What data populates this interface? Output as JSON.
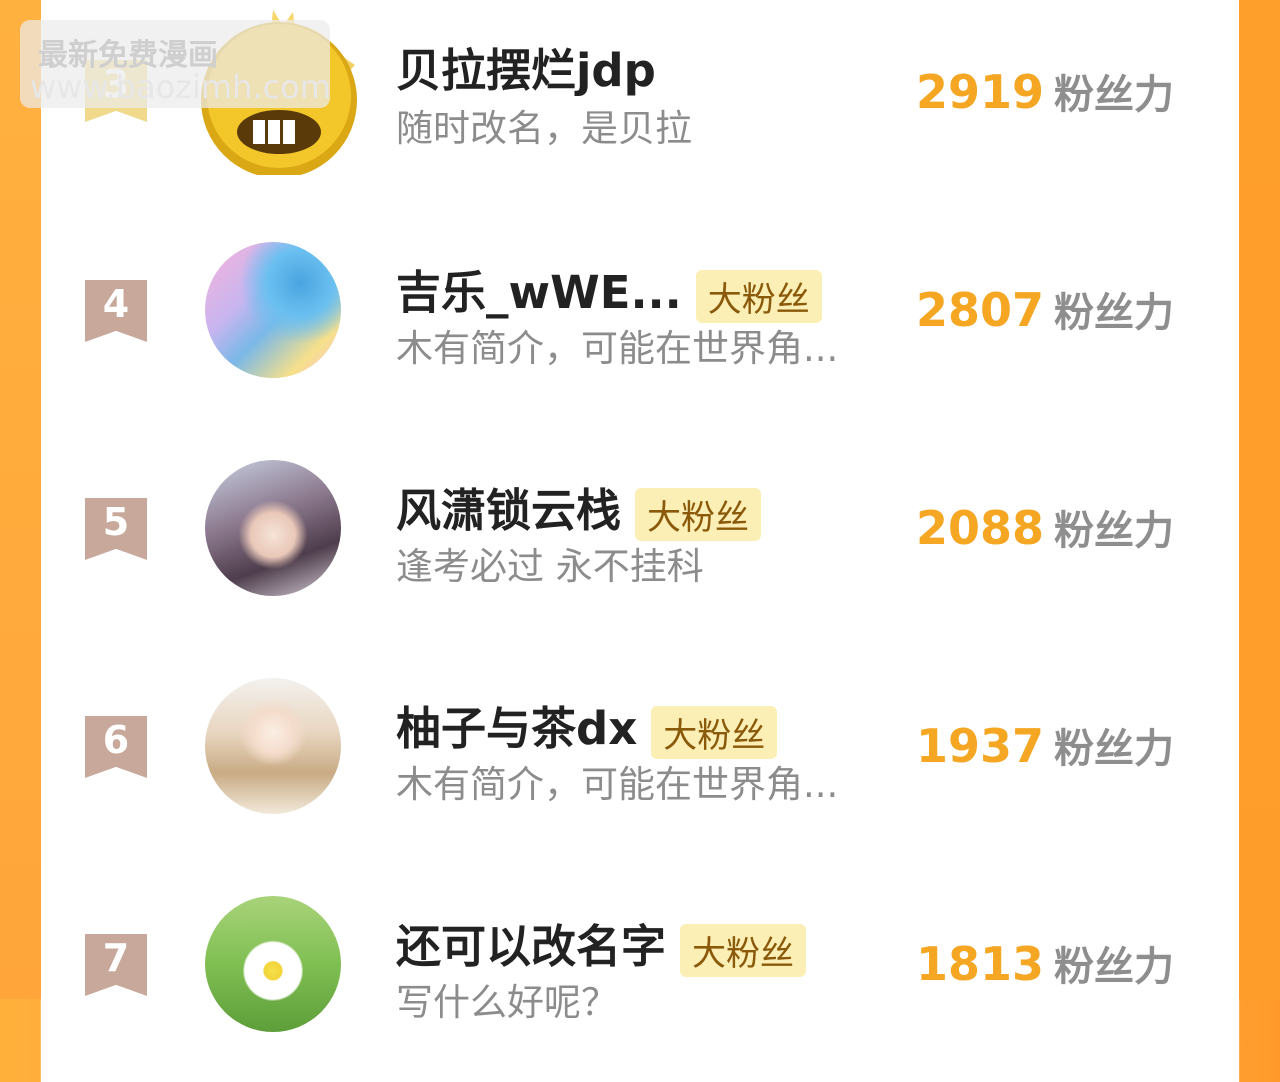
{
  "rows": [
    {
      "rank": "3",
      "name": "贝拉摆烂jdp",
      "badge": "",
      "bio": "随时改名，是贝拉",
      "score": "2919",
      "unit": "粉丝力"
    },
    {
      "rank": "4",
      "name": "吉乐_wWE...",
      "badge": "大粉丝",
      "bio": "木有简介，可能在世界角...",
      "score": "2807",
      "unit": "粉丝力"
    },
    {
      "rank": "5",
      "name": "风潇锁云栈",
      "badge": "大粉丝",
      "bio": "逢考必过 永不挂科",
      "score": "2088",
      "unit": "粉丝力"
    },
    {
      "rank": "6",
      "name": "柚子与茶dx",
      "badge": "大粉丝",
      "bio": "木有简介，可能在世界角...",
      "score": "1937",
      "unit": "粉丝力"
    },
    {
      "rank": "7",
      "name": "还可以改名字",
      "badge": "大粉丝",
      "bio": "写什么好呢？",
      "score": "1813",
      "unit": "粉丝力"
    }
  ],
  "watermark": {
    "line1": "最新免费漫画",
    "line2": "www.baozimh.com"
  },
  "colors": {
    "accent": "#f5a623",
    "side": "#ffa53a",
    "badge_bg": "#fbefb6",
    "rank_badge": "#c7a89a"
  }
}
